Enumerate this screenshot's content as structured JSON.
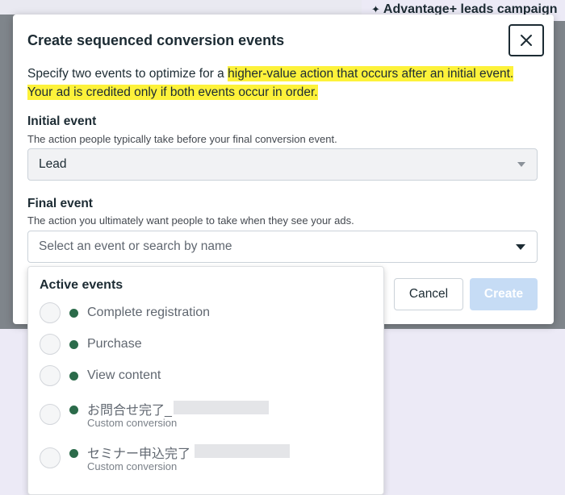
{
  "background": {
    "tab_label": "Advantage+ leads campaign",
    "tab_icon": "sparkle-icon"
  },
  "modal": {
    "title": "Create sequenced conversion events",
    "close_icon": "close-icon",
    "description_plain": "Specify two events to optimize for a ",
    "description_highlight_1": "higher-value action that occurs after an initial event.",
    "description_highlight_2": "Your ad is credited only if both events occur in order.",
    "initial_event": {
      "label": "Initial event",
      "help": "The action people typically take before your final conversion event.",
      "value": "Lead"
    },
    "final_event": {
      "label": "Final event",
      "help": "The action you ultimately want people to take when they see your ads.",
      "placeholder": "Select an event or search by name"
    },
    "buttons": {
      "cancel": "Cancel",
      "create": "Create"
    }
  },
  "dropdown": {
    "heading": "Active events",
    "items": [
      {
        "label": "Complete registration",
        "sub": ""
      },
      {
        "label": "Purchase",
        "sub": ""
      },
      {
        "label": "View content",
        "sub": ""
      },
      {
        "label": "お問合せ完了_",
        "sub": "Custom conversion"
      },
      {
        "label": "セミナー申込完了",
        "sub": "Custom conversion"
      }
    ]
  },
  "colors": {
    "highlight": "#fdf23a",
    "status_dot": "#2b6b4a",
    "create_button_disabled": "#c6dcf5"
  }
}
